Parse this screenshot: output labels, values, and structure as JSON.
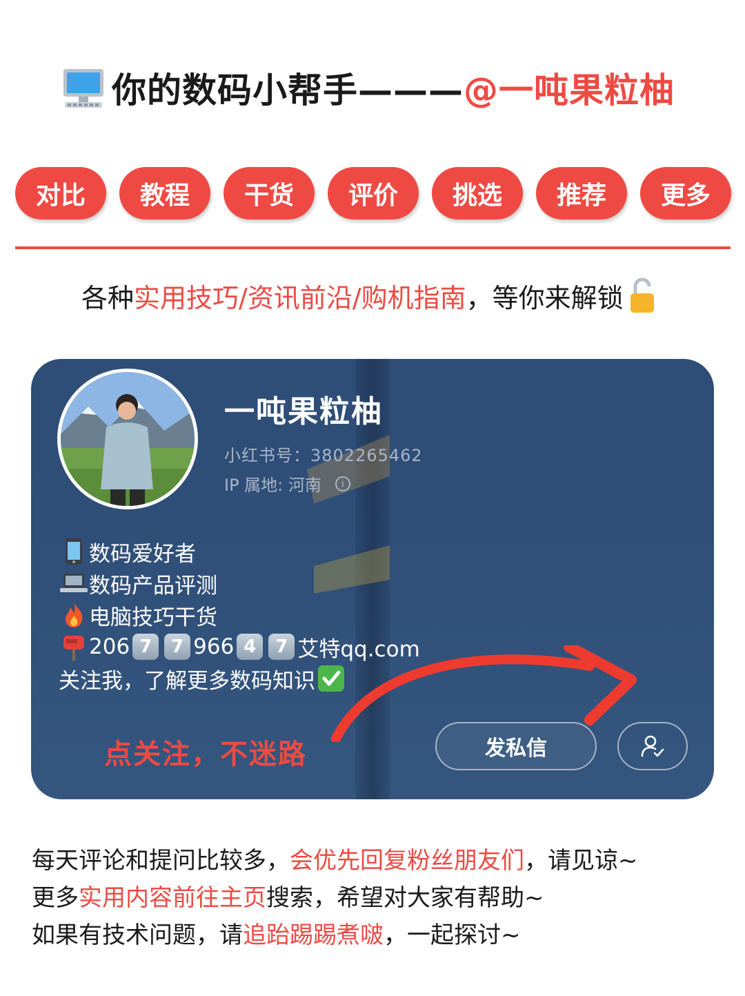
{
  "header": {
    "icon": "desktop-computer-icon",
    "title_main": "你的数码小帮手———",
    "title_handle": "@一吨果粒柚"
  },
  "tags": [
    "对比",
    "教程",
    "干货",
    "评价",
    "挑选",
    "推荐",
    "更多"
  ],
  "subtitle": {
    "prefix": "各种",
    "highlight": "实用技巧/资讯前沿/购机指南",
    "suffix": "，等你来解锁",
    "icon": "unlocked-padlock-icon"
  },
  "profile": {
    "name": "一吨果粒柚",
    "id_line": "小红书号：3802265462",
    "ip_line": "IP 属地: 河南",
    "bio": [
      {
        "icon": "mobile-phone-icon",
        "text": "数码爱好者"
      },
      {
        "icon": "laptop-icon",
        "text": "数码产品评测"
      },
      {
        "icon": "fire-icon",
        "text": "电脑技巧干货"
      }
    ],
    "contact": {
      "icon": "mailbox-icon",
      "part1": "206",
      "key1": "7",
      "key2": "7",
      "part2": "966",
      "key3": "4",
      "key4": "7",
      "part3": "艾特qq.com"
    },
    "follow_line": "关注我，了解更多数码知识",
    "follow_line_icon": "check-mark-button-icon",
    "follow_hint": "点关注，不迷路",
    "dm_button": "发私信",
    "follow_button_icon": "user-follow-icon"
  },
  "footer": {
    "line1": {
      "prefix": "每天评论和提问比较多，",
      "highlight": "会优先回复粉丝朋友们",
      "suffix": "，请见谅~"
    },
    "line2": {
      "prefix": "更多",
      "highlight": "实用内容前往主页",
      "suffix": "搜索，希望对大家有帮助~"
    },
    "line3": {
      "prefix": "如果有技术问题，请",
      "highlight": "追跆踢踢煮啵",
      "suffix": "，一起探讨~"
    }
  },
  "colors": {
    "accent": "#ee4a43",
    "card_bg": "#2f4f79",
    "text": "#1a1a1a"
  }
}
